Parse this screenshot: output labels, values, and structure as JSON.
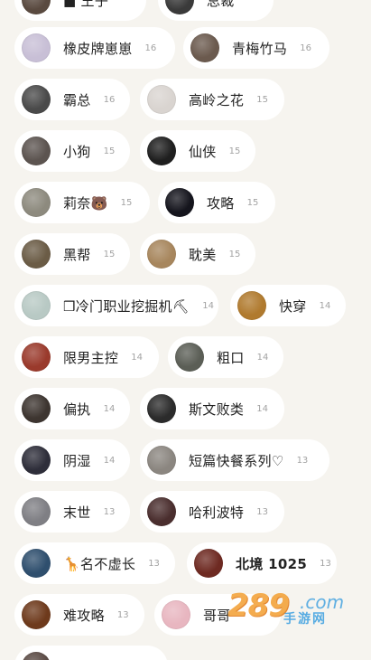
{
  "rows": [
    {
      "chips": [
        {
          "name": "■ 王子",
          "count": "",
          "avatar_color": "#5a4a40"
        },
        {
          "name": "总裁",
          "count": "",
          "avatar_color": "#3a3a3a"
        }
      ]
    },
    {
      "chips": [
        {
          "name": "橡皮牌崽崽",
          "count": "16",
          "avatar_color": "#c8bfd6"
        },
        {
          "name": "青梅竹马",
          "count": "16",
          "avatar_color": "#6b5a4e"
        }
      ]
    },
    {
      "chips": [
        {
          "name": "霸总",
          "count": "16",
          "avatar_color": "#4a4a4a"
        },
        {
          "name": "高岭之花",
          "count": "15",
          "avatar_color": "#d9d4d0"
        }
      ]
    },
    {
      "chips": [
        {
          "name": "小狗",
          "count": "15",
          "avatar_color": "#5c5450"
        },
        {
          "name": "仙侠",
          "count": "15",
          "avatar_color": "#1f1f1f"
        }
      ]
    },
    {
      "chips": [
        {
          "name": "莉奈🐻",
          "count": "15",
          "avatar_color": "#8d8a7e"
        },
        {
          "name": "攻略",
          "count": "15",
          "avatar_color": "#15151d"
        }
      ]
    },
    {
      "chips": [
        {
          "name": "黑帮",
          "count": "15",
          "avatar_color": "#6b5c46"
        },
        {
          "name": "耽美",
          "count": "15",
          "avatar_color": "#a7865d"
        }
      ]
    },
    {
      "chips": [
        {
          "name": "❒冷门职业挖掘机⛏",
          "count": "14",
          "avatar_color": "#b8c9c4"
        },
        {
          "name": "快穿",
          "count": "14",
          "avatar_color": "#b07a2e"
        }
      ]
    },
    {
      "chips": [
        {
          "name": "限男主控",
          "count": "14",
          "avatar_color": "#9a3a2c"
        },
        {
          "name": "粗口",
          "count": "14",
          "avatar_color": "#5b5e56"
        }
      ]
    },
    {
      "chips": [
        {
          "name": "偏执",
          "count": "14",
          "avatar_color": "#3d3530"
        },
        {
          "name": "斯文败类",
          "count": "14",
          "avatar_color": "#2b2b2b"
        }
      ]
    },
    {
      "chips": [
        {
          "name": "阴湿",
          "count": "14",
          "avatar_color": "#2e2e3a"
        },
        {
          "name": "短篇快餐系列♡",
          "count": "13",
          "avatar_color": "#8b8680"
        }
      ]
    },
    {
      "chips": [
        {
          "name": "末世",
          "count": "13",
          "avatar_color": "#7f7f84"
        },
        {
          "name": "哈利波特",
          "count": "13",
          "avatar_color": "#4a2e2e"
        }
      ]
    },
    {
      "chips": [
        {
          "name": "🦒名不虚长",
          "count": "13",
          "avatar_color": "#2f4f6e"
        },
        {
          "name": "北境 1025",
          "count": "13",
          "avatar_color": "#6e2a22",
          "bold": true
        }
      ]
    },
    {
      "chips": [
        {
          "name": "难攻略",
          "count": "13",
          "avatar_color": "#6e3a1c"
        },
        {
          "name": "哥哥",
          "count": "",
          "avatar_color": "#e8b6c0"
        }
      ]
    },
    {
      "chips": [
        {
          "name": "",
          "count": "",
          "avatar_color": "#5a4a44"
        }
      ]
    }
  ],
  "watermark": {
    "number": "289",
    "suffix": ".com",
    "cn": "手游网"
  }
}
